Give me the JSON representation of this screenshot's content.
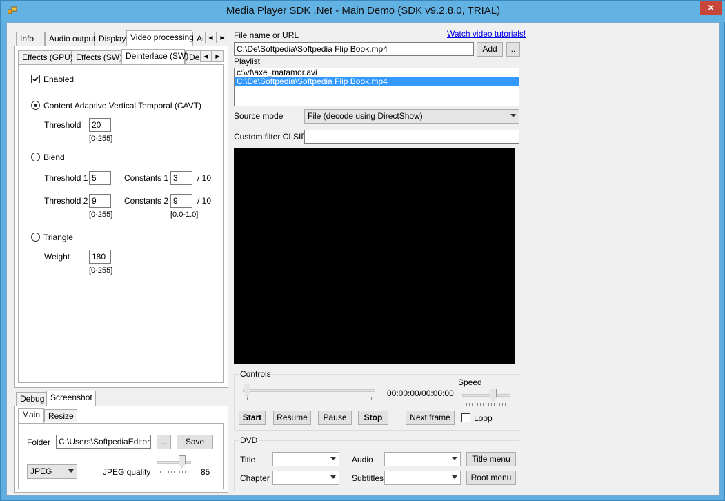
{
  "window": {
    "title": "Media Player SDK .Net - Main Demo (SDK v9.2.8.0, TRIAL)",
    "close_label": "✕"
  },
  "main_tabs": [
    "Info",
    "Audio output",
    "Display",
    "Video processing",
    "Au"
  ],
  "sub_tabs": [
    "Effects (GPU)",
    "Effects (SW)",
    "Deinterlace (SW)",
    "De"
  ],
  "deinterlace": {
    "enabled_label": "Enabled",
    "cavt_label": "Content Adaptive Vertical Temporal (CAVT)",
    "threshold_label": "Threshold",
    "threshold_value": "20",
    "threshold_range": "[0-255]",
    "blend_label": "Blend",
    "threshold1_label": "Threshold 1",
    "threshold1_value": "5",
    "constants1_label": "Constants 1",
    "constants1_value": "3",
    "constants1_suffix": "/ 10",
    "threshold2_label": "Threshold 2",
    "threshold2_value": "9",
    "constants2_label": "Constants 2",
    "constants2_value": "9",
    "constants2_suffix": "/ 10",
    "blend_threshold_range": "[0-255]",
    "blend_constants_range": "[0.0-1.0]",
    "triangle_label": "Triangle",
    "weight_label": "Weight",
    "weight_value": "180",
    "weight_range": "[0-255]"
  },
  "bottom_tabs": [
    "Debug",
    "Screenshot"
  ],
  "screenshot_tabs": [
    "Main",
    "Resize"
  ],
  "screenshot": {
    "folder_label": "Folder",
    "folder_value": "C:\\Users\\SoftpediaEditor\\Do",
    "browse_label": "..",
    "save_label": "Save",
    "format_value": "JPEG",
    "quality_label": "JPEG quality",
    "quality_value": "85"
  },
  "file": {
    "label": "File name or URL",
    "tutorials_link": "Watch video tutorials!",
    "value": "C:\\De\\Softpedia\\Softpedia Flip Book.mp4",
    "add_label": "Add",
    "browse_label": ".."
  },
  "playlist": {
    "label": "Playlist",
    "items": [
      "c:\\vf\\axe_matamor.avi",
      "C:\\De\\Softpedia\\Softpedia Flip Book.mp4"
    ]
  },
  "source_mode": {
    "label": "Source mode",
    "value": "File (decode using DirectShow)"
  },
  "custom_filter": {
    "label": "Custom filter CLSID",
    "value": ""
  },
  "controls": {
    "title": "Controls",
    "time": "00:00:00/00:00:00",
    "speed_label": "Speed",
    "start": "Start",
    "resume": "Resume",
    "pause": "Pause",
    "stop": "Stop",
    "next_frame": "Next frame",
    "loop_label": "Loop"
  },
  "dvd": {
    "title": "DVD",
    "title_label": "Title",
    "audio_label": "Audio",
    "title_menu": "Title menu",
    "chapter_label": "Chapter",
    "subtitles_label": "Subtitles",
    "root_menu": "Root menu"
  },
  "icons": {
    "app": "app-icon",
    "check": "check-icon",
    "arrow_left": "arrow-left-icon",
    "arrow_right": "arrow-right-icon"
  }
}
